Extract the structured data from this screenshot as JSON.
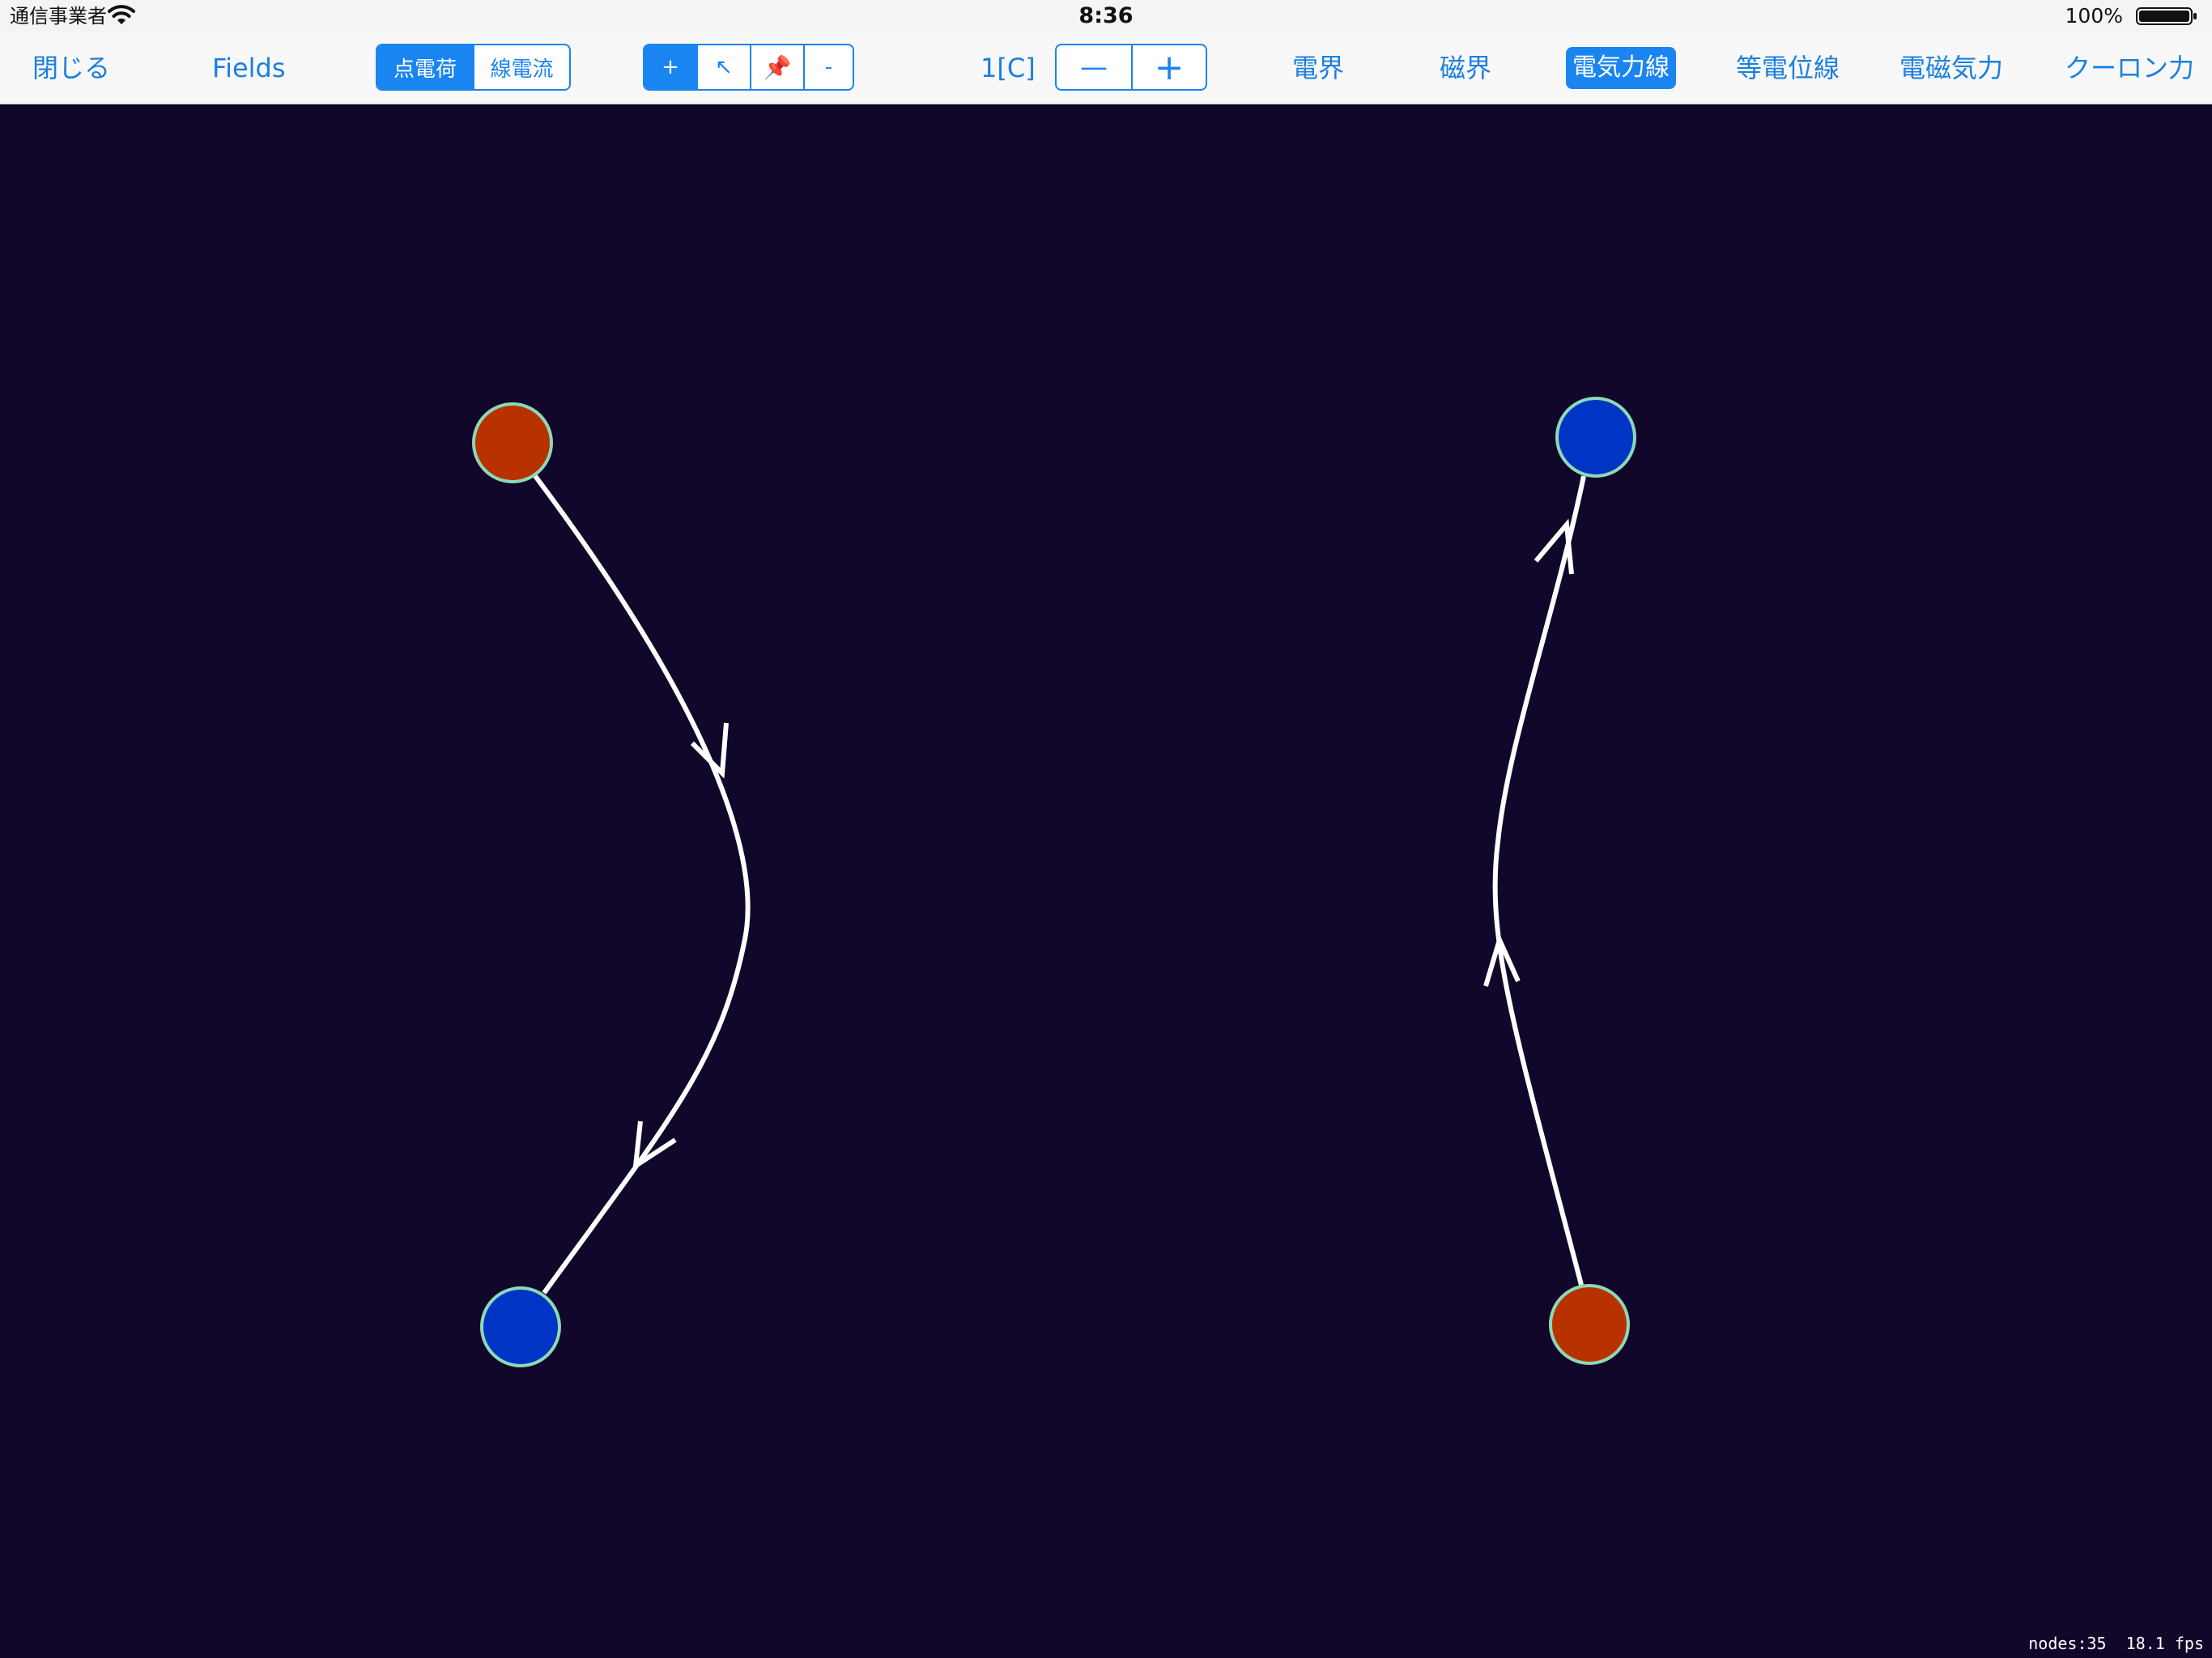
{
  "status_bar": {
    "carrier": "通信事業者",
    "time": "8:36",
    "battery": "100%"
  },
  "toolbar": {
    "close_label": "閉じる",
    "fields_label": "Fields",
    "mode_segment": [
      "点電荷",
      "線電流"
    ],
    "mode_selected": 0,
    "tool_segment": [
      "+",
      "↖",
      "📌",
      "-"
    ],
    "tool_selected": 0,
    "charge_value": "1[C]",
    "stepper": [
      "—",
      "+"
    ],
    "display_buttons": [
      "電界",
      "磁界",
      "電気力線",
      "等電位線",
      "電磁気力",
      "クーロン力"
    ],
    "display_active": "電気力線"
  },
  "canvas": {
    "charges": [
      {
        "polarity": "positive",
        "color": "#b83200"
      },
      {
        "polarity": "negative",
        "color": "#0034c4"
      },
      {
        "polarity": "negative",
        "color": "#0034c4"
      },
      {
        "polarity": "positive",
        "color": "#b83200"
      }
    ],
    "charge_outline_color": "#8ed8b6",
    "field_line_color": "#ffffff",
    "background_color": "#10072a"
  },
  "debug": {
    "nodes": "nodes:35",
    "fps": "18.1 fps"
  }
}
